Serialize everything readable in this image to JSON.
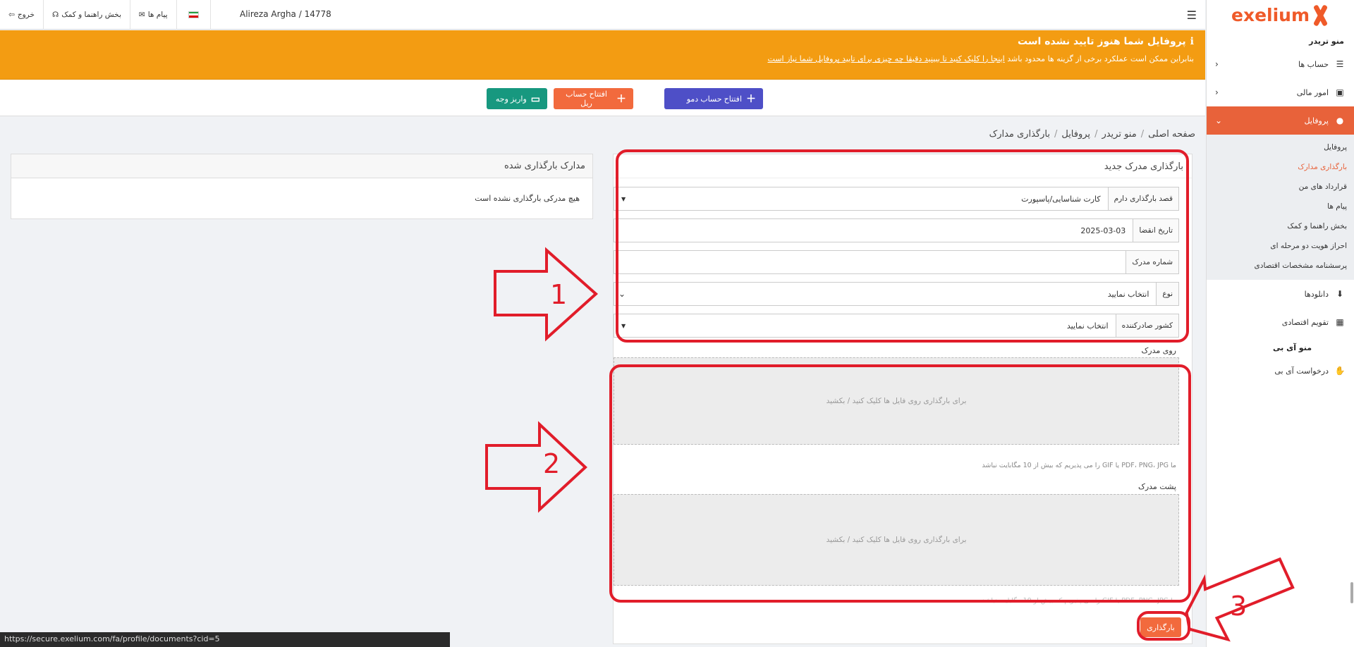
{
  "topbar": {
    "user": "Alireza Argha / 14778",
    "messages": "پیام ها",
    "help": "بخش راهنما و کمک",
    "logout": "خروج"
  },
  "alert": {
    "title": "پروفایل شما هنوز تایید نشده است",
    "text_before": "بنابراین ممکن است عملکرد برخی از گزینه ها محدود باشد ",
    "link": "اینجا را کلیک کنید تا ببینید دقیقا چه چیزی برای تایید پروفایل شما نیاز است"
  },
  "actions": {
    "demo": "افتتاح حساب دمو",
    "real": "افتتاح حساب ریل",
    "deposit": "واریز وجه"
  },
  "breadcrumb": [
    "صفحه اصلی",
    "منو تریدر",
    "پروفایل",
    "بارگذاری مدارک"
  ],
  "sidebar": {
    "logo": "exelium",
    "trader_menu": "منو تریدر",
    "items": [
      {
        "label": "حساب ها"
      },
      {
        "label": "امور مالی"
      },
      {
        "label": "پروفایل"
      }
    ],
    "submenu": [
      "پروفایل",
      "بارگذاری مدارک",
      "قرارداد های من",
      "پیام ها",
      "بخش راهنما و کمک",
      "احراز هویت دو مرحله ای",
      "پرسشنامه مشخصات اقتصادی"
    ],
    "downloads": "دانلودها",
    "calendar": "تقویم اقتصادی",
    "ib_menu": "منو آی بی",
    "ib_request": "درخواست آی بی"
  },
  "upload": {
    "title": "بارگذاری مدرک جدید",
    "intent_label": "قصد بارگذاری دارم",
    "intent_value": "کارت شناسایی/پاسپورت",
    "expiry_label": "تاریخ انقضا",
    "expiry_value": "2025-03-03",
    "number_label": "شماره مدرک",
    "number_value": "",
    "type_label": "نوع",
    "type_value": "انتخاب نمایید",
    "country_label": "کشور صادرکننده",
    "country_value": "انتخاب نمایید",
    "front_label": "روی مدرک",
    "back_label": "پشت مدرک",
    "dropzone_text": "برای بارگذاری روی فایل ها کلیک کنید / بکشید",
    "hint": "ما PDF، PNG، JPG یا GIF را می پذیریم که بیش از 10 مگابایت نباشد",
    "submit": "بارگذاری"
  },
  "docs": {
    "title": "مدارک بارگذاری شده",
    "empty": "هیچ مدرکی بارگذاری نشده است"
  },
  "status_url": "https://secure.exelium.com/fa/profile/documents?cid=5",
  "annotations": [
    "1",
    "2",
    "3"
  ],
  "colors": {
    "accent": "#e8623a",
    "alert": "#f39c12",
    "annotation": "#e11d2a"
  }
}
